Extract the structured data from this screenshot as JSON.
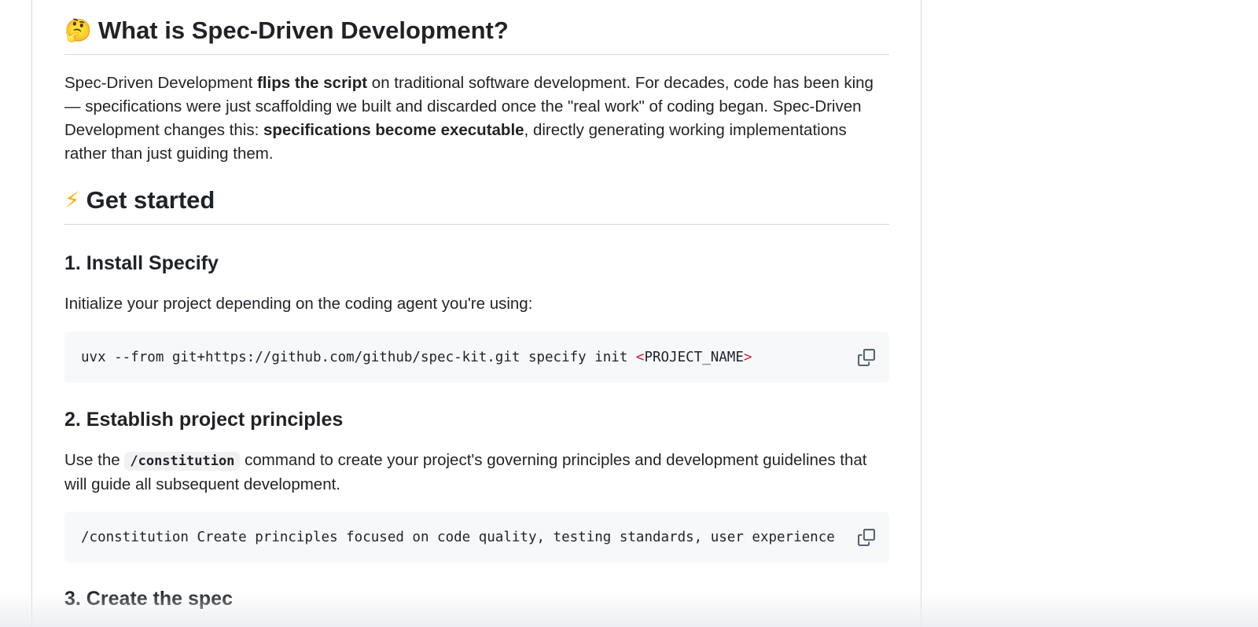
{
  "what_is": {
    "emoji": "🤔",
    "heading": "What is Spec-Driven Development?",
    "para_1": "Spec-Driven Development ",
    "para_bold_1": "flips the script",
    "para_2": " on traditional software development. For decades, code has been king — specifications were just scaffolding we built and discarded once the \"real work\" of coding began. Spec-Driven Development changes this: ",
    "para_bold_2": "specifications become executable",
    "para_3": ", directly generating working implementations rather than just guiding them."
  },
  "get_started": {
    "emoji": "⚡",
    "heading": "Get started"
  },
  "step_1": {
    "heading": "1. Install Specify",
    "description": "Initialize your project depending on the coding agent you're using:",
    "code_main": "uvx --from git+https://github.com/github/spec-kit.git specify init ",
    "code_lt": "<",
    "code_arg": "PROJECT_NAME",
    "code_gt": ">"
  },
  "step_2": {
    "heading": "2. Establish project principles",
    "desc_1": "Use the ",
    "inline_code": "/constitution",
    "desc_2": " command to create your project's governing principles and development guidelines that will guide all subsequent development.",
    "code": "/constitution Create principles focused on code quality, testing standards, user experience co"
  },
  "step_3": {
    "heading": "3. Create the spec"
  },
  "icons": {
    "copy": "copy-icon"
  }
}
